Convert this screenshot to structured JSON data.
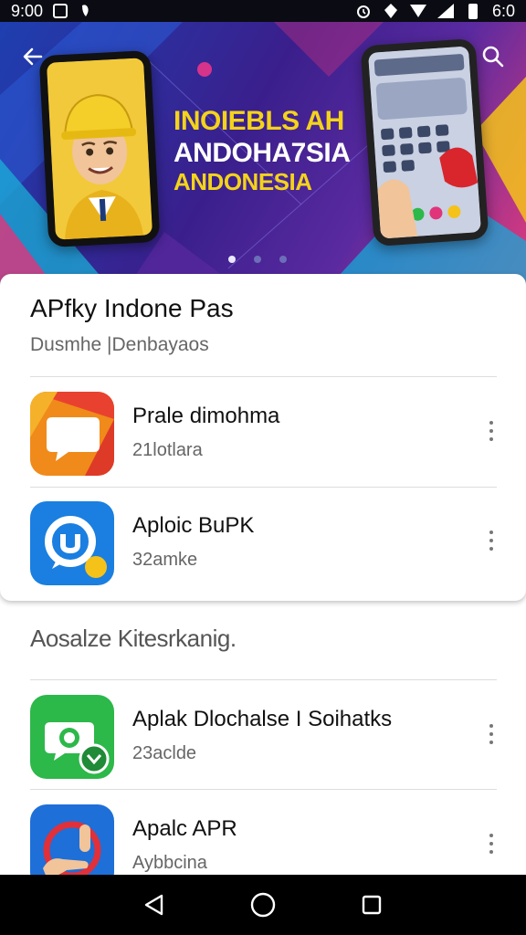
{
  "status_bar": {
    "time": "9:00",
    "right_text": "6:0",
    "icons": [
      "gallery-icon",
      "notification-icon",
      "alarm-icon",
      "location-icon",
      "wifi-icon",
      "signal-icon",
      "battery-icon"
    ]
  },
  "hero": {
    "line1": "INOIEBLS AH",
    "line2": "ANDOHA7SIA",
    "line3": "ANDONESIA",
    "carousel_pages": 3,
    "active_page": 1
  },
  "card": {
    "title": "APfky Indone Pas",
    "subtitle": "Dusmhe |Denbayaos",
    "apps": [
      {
        "name": "Prale dimohma",
        "meta": "21lotlara",
        "icon": "chat-bubble-icon",
        "color": "#f08a1a"
      },
      {
        "name": "Aploic BuPK",
        "meta": "32amke",
        "icon": "messenger-icon",
        "color": "#1a7fe0"
      }
    ]
  },
  "section": {
    "title": "Aosalze Kitesrkanig.",
    "apps": [
      {
        "name": "Aplak Dlochalse I Soihatks",
        "meta": "23aclde",
        "icon": "camera-chat-icon",
        "color": "#2db84a"
      },
      {
        "name": "Apalc APR",
        "meta": "Aybbcina",
        "icon": "hand-app-icon",
        "color": "#1e6fd8"
      }
    ]
  },
  "colors": {
    "accent_yellow": "#f4d31a",
    "hero_blue": "#1e3fb0",
    "hero_purple": "#3a1f8c"
  }
}
